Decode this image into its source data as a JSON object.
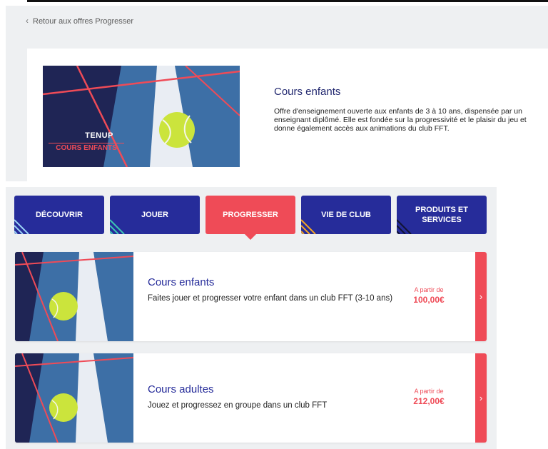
{
  "back_link": {
    "label": "Retour aux offres Progresser"
  },
  "detail": {
    "title": "Cours enfants",
    "description": "Offre d'enseignement ouverte aux enfants de 3 à 10 ans, dispensée par un enseignant diplômé. Elle est fondée sur la progressivité et le plaisir du jeu et donne également accès aux animations du club FFT.",
    "image_brand": "TENUP",
    "image_caption": "COURS ENFANTS"
  },
  "tabs": [
    {
      "label": "DÉCOUVRIR",
      "accent": "#9ad3f5"
    },
    {
      "label": "JOUER",
      "accent": "#3cc8b4"
    },
    {
      "label": "PROGRESSER",
      "accent": "#ef4b57"
    },
    {
      "label": "VIE DE CLUB",
      "accent": "#f5a623"
    },
    {
      "label": "PRODUITS ET SERVICES",
      "accent": "#1b1e4d"
    }
  ],
  "offers": [
    {
      "title": "Cours enfants",
      "description": "Faites jouer et progresser votre enfant dans un club FFT (3-10 ans)",
      "price_label": "A partir de",
      "price": "100,00€"
    },
    {
      "title": "Cours adultes",
      "description": "Jouez et progressez en groupe dans un club FFT",
      "price_label": "A partir de",
      "price": "212,00€"
    }
  ],
  "colors": {
    "navy": "#262c9a",
    "red": "#ef4b57",
    "panel_bg": "#eef0f2"
  }
}
